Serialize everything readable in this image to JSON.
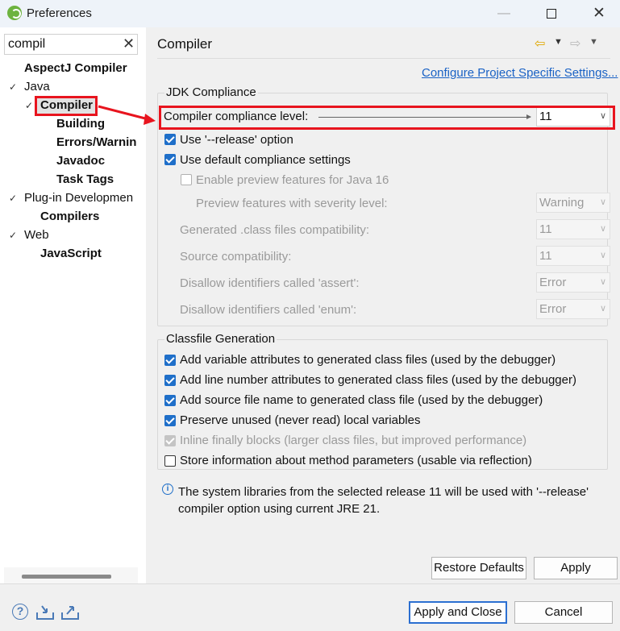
{
  "window": {
    "title": "Preferences"
  },
  "filter": {
    "value": "compil"
  },
  "tree": {
    "aspectj": "AspectJ Compiler",
    "java": "Java",
    "compiler": "Compiler",
    "building": "Building",
    "errors": "Errors/Warnin",
    "javadoc": "Javadoc",
    "task_tags": "Task Tags",
    "plugin_dev": "Plug-in Developmen",
    "compilers": "Compilers",
    "web": "Web",
    "javascript": "JavaScript"
  },
  "page": {
    "title": "Compiler",
    "configure_link": "Configure Project Specific Settings..."
  },
  "jdk": {
    "group_title": "JDK Compliance",
    "compliance_label": "Compiler compliance level:",
    "compliance_value": "11",
    "release_option": "Use '--release' option",
    "release_checked": true,
    "default_settings": "Use default compliance settings",
    "default_checked": true,
    "preview_features": "Enable preview features for Java 16",
    "preview_checked": false,
    "severity_label": "Preview features with severity level:",
    "severity_value": "Warning",
    "class_compat_label": "Generated .class files compatibility:",
    "class_compat_value": "11",
    "source_compat_label": "Source compatibility:",
    "source_compat_value": "11",
    "assert_label": "Disallow identifiers called 'assert':",
    "assert_value": "Error",
    "enum_label": "Disallow identifiers called 'enum':",
    "enum_value": "Error"
  },
  "classfile": {
    "group_title": "Classfile Generation",
    "items": [
      {
        "label": "Add variable attributes to generated class files (used by the debugger)",
        "checked": true
      },
      {
        "label": "Add line number attributes to generated class files (used by the debugger)",
        "checked": true
      },
      {
        "label": "Add source file name to generated class file (used by the debugger)",
        "checked": true
      },
      {
        "label": "Preserve unused (never read) local variables",
        "checked": true
      },
      {
        "label": "Inline finally blocks (larger class files, but improved performance)",
        "checked": true
      },
      {
        "label": "Store information about method parameters (usable via reflection)",
        "checked": false
      }
    ]
  },
  "info": {
    "text": "The system libraries from the selected release 11 will be used with '--release' compiler option using current JRE 21."
  },
  "buttons": {
    "restore_defaults": "Restore Defaults",
    "apply": "Apply",
    "apply_and_close": "Apply and Close",
    "cancel": "Cancel"
  },
  "colors": {
    "accent": "#1f6fc9",
    "highlight": "#e8141e",
    "link": "#1a62c5"
  }
}
